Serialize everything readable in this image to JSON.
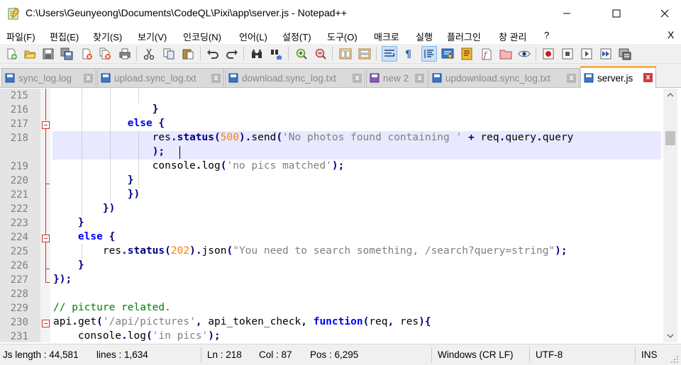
{
  "window": {
    "title": "C:\\Users\\Geunyeong\\Documents\\CodeQL\\Pixi\\app\\server.js - Notepad++",
    "minimize_label": "—",
    "maximize_label": "☐",
    "close_label": "✕"
  },
  "menu": {
    "items": [
      "파일(F)",
      "편집(E)",
      "찾기(S)",
      "보기(V)",
      "인코딩(N)",
      "언어(L)",
      "설정(T)",
      "도구(O)",
      "매크로",
      "실행",
      "플러그인",
      "창 관리",
      "?"
    ],
    "close_label": "X"
  },
  "toolbar": {
    "icons": [
      "new-file-icon",
      "open-file-icon",
      "save-icon",
      "save-all-icon",
      "close-icon",
      "close-all-icon",
      "print-icon",
      "cut-icon",
      "copy-icon",
      "paste-icon",
      "undo-icon",
      "redo-icon",
      "find-icon",
      "replace-icon",
      "zoom-in-icon",
      "zoom-out-icon",
      "sync-vertical-icon",
      "sync-horizontal-icon",
      "word-wrap-icon",
      "show-all-chars-icon",
      "indent-guide-icon",
      "user-language-icon",
      "document-map-icon",
      "function-list-icon",
      "folder-workspace-icon",
      "monitoring-icon",
      "record-macro-icon",
      "stop-record-icon",
      "play-macro-icon",
      "run-macro-multiple-icon",
      "save-macro-icon"
    ]
  },
  "tabs": [
    {
      "label": "sync_log.log",
      "active": false
    },
    {
      "label": "upload.sync_log.txt",
      "active": false
    },
    {
      "label": "download.sync_log.txt",
      "active": false
    },
    {
      "label": "new 2",
      "active": false
    },
    {
      "label": "updownload.sync_log.txt",
      "active": false
    },
    {
      "label": "server.js",
      "active": true
    }
  ],
  "editor": {
    "line_numbers": [
      "215",
      "216",
      "217",
      "218",
      "",
      "219",
      "220",
      "221",
      "222",
      "223",
      "224",
      "225",
      "226",
      "227",
      "228",
      "229",
      "230",
      "231"
    ],
    "current_line": "218"
  },
  "status": {
    "length": "Js length : 44,581",
    "lines": "lines : 1,634",
    "ln": "Ln : 218",
    "col": "Col : 87",
    "pos": "Pos : 6,295",
    "eol": "Windows (CR LF)",
    "encoding": "UTF-8",
    "mode": "INS"
  },
  "colors": {
    "keyword": "#0000ff",
    "number": "#ff8000",
    "string": "#808080",
    "comment": "#008000",
    "current_line": "#e8e8ff",
    "active_tab_accent": "#f6b24a"
  }
}
